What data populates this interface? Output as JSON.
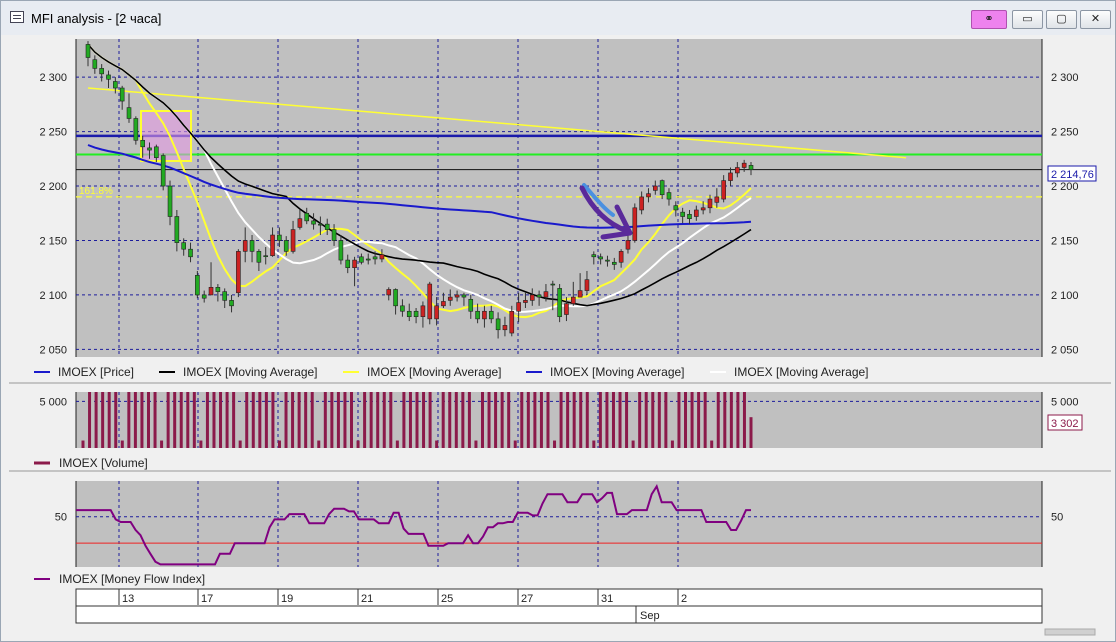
{
  "window": {
    "title": "MFI analysis - [2 часа]",
    "buttons": {
      "link": "⚭",
      "minimize": "▭",
      "restore": "▢",
      "close": "✕"
    }
  },
  "colors": {
    "plot_bg": "#c0c0c0",
    "grid": "#1c1c9c",
    "up": "#22aa22",
    "down": "#cc2222",
    "ma_black": "#000000",
    "ma_yellow": "#ffff33",
    "ma_blue": "#1a1acc",
    "ma_white": "#ffffff",
    "volume": "#8b1a4a",
    "mfi": "#800080",
    "h_blue": "#1a1aaa",
    "h_green": "#22ee22",
    "mfi_level": "#ee2222",
    "arrow_purple": "#5a2a9a",
    "arrow_blue": "#4a90e0"
  },
  "chart_data": [
    {
      "type": "candlestick",
      "title": "",
      "y_ticks": [
        "2 300",
        "2 250",
        "2 200",
        "2 150",
        "2 100",
        "2 050"
      ],
      "ylim": [
        2043,
        2335
      ],
      "current_price_label": "2 214,76",
      "fib_label": "161.8%",
      "legend": [
        "IMOEX [Price]",
        "IMOEX [Moving Average]",
        "IMOEX [Moving Average]",
        "IMOEX [Moving Average]",
        "IMOEX [Moving Average]"
      ],
      "candles": [
        [
          2318,
          2333,
          2310,
          2330
        ],
        [
          2308,
          2320,
          2303,
          2316
        ],
        [
          2303,
          2312,
          2296,
          2308
        ],
        [
          2298,
          2306,
          2290,
          2302
        ],
        [
          2290,
          2300,
          2285,
          2296
        ],
        [
          2278,
          2292,
          2270,
          2290
        ],
        [
          2262,
          2285,
          2258,
          2272
        ],
        [
          2242,
          2264,
          2238,
          2262
        ],
        [
          2236,
          2246,
          2226,
          2242
        ],
        [
          2233,
          2240,
          2225,
          2235
        ],
        [
          2226,
          2238,
          2222,
          2236
        ],
        [
          2200,
          2230,
          2196,
          2228
        ],
        [
          2172,
          2205,
          2164,
          2200
        ],
        [
          2148,
          2178,
          2140,
          2172
        ],
        [
          2142,
          2152,
          2136,
          2148
        ],
        [
          2135,
          2148,
          2130,
          2142
        ],
        [
          2100,
          2122,
          2097,
          2118
        ],
        [
          2097,
          2104,
          2093,
          2100
        ],
        [
          2107,
          2130,
          2100,
          2100
        ],
        [
          2103,
          2110,
          2094,
          2107
        ],
        [
          2095,
          2106,
          2088,
          2103
        ],
        [
          2090,
          2100,
          2084,
          2095
        ],
        [
          2140,
          2142,
          2098,
          2102
        ],
        [
          2150,
          2162,
          2130,
          2140
        ],
        [
          2140,
          2155,
          2130,
          2150
        ],
        [
          2130,
          2142,
          2122,
          2140
        ],
        [
          2136,
          2144,
          2128,
          2136
        ],
        [
          2155,
          2162,
          2135,
          2136
        ],
        [
          2150,
          2162,
          2144,
          2155
        ],
        [
          2140,
          2154,
          2136,
          2150
        ],
        [
          2160,
          2168,
          2138,
          2140
        ],
        [
          2170,
          2178,
          2160,
          2162
        ],
        [
          2168,
          2180,
          2165,
          2175
        ],
        [
          2165,
          2175,
          2160,
          2168
        ],
        [
          2165,
          2172,
          2155,
          2165
        ],
        [
          2160,
          2170,
          2155,
          2165
        ],
        [
          2150,
          2165,
          2145,
          2160
        ],
        [
          2132,
          2155,
          2128,
          2150
        ],
        [
          2125,
          2137,
          2120,
          2132
        ],
        [
          2132,
          2135,
          2108,
          2125
        ],
        [
          2130,
          2138,
          2128,
          2135
        ],
        [
          2132,
          2138,
          2128,
          2133
        ],
        [
          2133,
          2140,
          2128,
          2135
        ],
        [
          2137,
          2142,
          2130,
          2133
        ],
        [
          2105,
          2107,
          2095,
          2100
        ],
        [
          2090,
          2106,
          2082,
          2105
        ],
        [
          2085,
          2096,
          2080,
          2090
        ],
        [
          2080,
          2092,
          2076,
          2085
        ],
        [
          2080,
          2088,
          2074,
          2085
        ],
        [
          2090,
          2094,
          2070,
          2080
        ],
        [
          2110,
          2112,
          2073,
          2078
        ],
        [
          2090,
          2098,
          2072,
          2078
        ],
        [
          2094,
          2102,
          2088,
          2090
        ],
        [
          2098,
          2105,
          2090,
          2095
        ],
        [
          2100,
          2104,
          2094,
          2098
        ],
        [
          2098,
          2102,
          2090,
          2100
        ],
        [
          2085,
          2100,
          2078,
          2096
        ],
        [
          2078,
          2092,
          2074,
          2085
        ],
        [
          2085,
          2090,
          2070,
          2078
        ],
        [
          2078,
          2090,
          2074,
          2085
        ],
        [
          2068,
          2084,
          2060,
          2078
        ],
        [
          2072,
          2080,
          2062,
          2068
        ],
        [
          2085,
          2090,
          2062,
          2065
        ],
        [
          2093,
          2102,
          2075,
          2085
        ],
        [
          2095,
          2102,
          2088,
          2093
        ],
        [
          2100,
          2106,
          2090,
          2095
        ],
        [
          2098,
          2104,
          2090,
          2100
        ],
        [
          2103,
          2110,
          2094,
          2098
        ],
        [
          2110,
          2113,
          2086,
          2110
        ],
        [
          2080,
          2110,
          2075,
          2106
        ],
        [
          2092,
          2098,
          2076,
          2082
        ],
        [
          2098,
          2112,
          2090,
          2092
        ],
        [
          2104,
          2120,
          2098,
          2098
        ],
        [
          2114,
          2122,
          2100,
          2104
        ],
        [
          2135,
          2140,
          2128,
          2137
        ],
        [
          2133,
          2138,
          2128,
          2135
        ],
        [
          2131,
          2136,
          2126,
          2132
        ],
        [
          2128,
          2134,
          2123,
          2130
        ],
        [
          2140,
          2142,
          2125,
          2130
        ],
        [
          2150,
          2158,
          2138,
          2142
        ],
        [
          2180,
          2184,
          2148,
          2150
        ],
        [
          2190,
          2195,
          2174,
          2178
        ],
        [
          2193,
          2198,
          2185,
          2190
        ],
        [
          2200,
          2205,
          2192,
          2196
        ],
        [
          2192,
          2206,
          2188,
          2205
        ],
        [
          2188,
          2198,
          2182,
          2194
        ],
        [
          2178,
          2186,
          2172,
          2182
        ],
        [
          2172,
          2180,
          2166,
          2176
        ],
        [
          2170,
          2178,
          2165,
          2174
        ],
        [
          2178,
          2182,
          2168,
          2172
        ],
        [
          2180,
          2186,
          2174,
          2178
        ],
        [
          2188,
          2192,
          2175,
          2180
        ],
        [
          2190,
          2198,
          2180,
          2185
        ],
        [
          2205,
          2210,
          2185,
          2188
        ],
        [
          2212,
          2217,
          2200,
          2205
        ],
        [
          2217,
          2222,
          2208,
          2212
        ],
        [
          2221,
          2224,
          2213,
          2217
        ],
        [
          2215,
          2222,
          2210,
          2219
        ]
      ]
    },
    {
      "type": "bar",
      "title": "",
      "y_ticks": [
        "5 000"
      ],
      "ylim": [
        0,
        6000
      ],
      "current_value_label": "3 302",
      "legend": [
        "IMOEX [Volume]"
      ],
      "values": [
        800,
        6000,
        6000,
        6000,
        6000,
        6000,
        800,
        6000,
        6000,
        6000,
        6000,
        6000,
        800,
        6000,
        6000,
        6000,
        6000,
        6000,
        800,
        6000,
        6000,
        6000,
        6000,
        6000,
        800,
        6000,
        6000,
        6000,
        6000,
        6000,
        800,
        6000,
        6000,
        6000,
        6000,
        6000,
        800,
        6000,
        6000,
        6000,
        6000,
        6000,
        800,
        6000,
        6000,
        6000,
        6000,
        6000,
        800,
        6000,
        6000,
        6000,
        6000,
        6000,
        800,
        6000,
        6000,
        6000,
        6000,
        6000,
        800,
        6000,
        6000,
        6000,
        6000,
        6000,
        800,
        6000,
        6000,
        6000,
        6000,
        6000,
        800,
        6000,
        6000,
        6000,
        6000,
        6000,
        800,
        6000,
        6000,
        6000,
        6000,
        6000,
        800,
        6000,
        6000,
        6000,
        6000,
        6000,
        800,
        6000,
        6000,
        6000,
        6000,
        6000,
        800,
        6000,
        6000,
        6000,
        6000,
        6000,
        3302
      ]
    },
    {
      "type": "line",
      "title": "",
      "y_ticks": [
        "50"
      ],
      "ylim": [
        12,
        77
      ],
      "level": 30,
      "legend": [
        "IMOEX [Money Flow Index]"
      ],
      "values": [
        55,
        55,
        55,
        55,
        55,
        55,
        55,
        55,
        48,
        46,
        46,
        46,
        40,
        36,
        28,
        22,
        16,
        14,
        14,
        14,
        14,
        14,
        14,
        14,
        14,
        14,
        14,
        14,
        14,
        22,
        22,
        22,
        30,
        30,
        30,
        30,
        30,
        30,
        30,
        42,
        48,
        48,
        48,
        52,
        52,
        52,
        52,
        45,
        45,
        45,
        45,
        52,
        56,
        56,
        56,
        54,
        54,
        48,
        48,
        48,
        48,
        45,
        45,
        45,
        53,
        53,
        41,
        37,
        37,
        37,
        37,
        28,
        28,
        28,
        28,
        30,
        30,
        30,
        30,
        36,
        30,
        30,
        35,
        42,
        42,
        45,
        45,
        46,
        46,
        53,
        53,
        53,
        51,
        51,
        60,
        67,
        67,
        67,
        67,
        61,
        61,
        61,
        67,
        67,
        67,
        61,
        64,
        68,
        68,
        52,
        52,
        52,
        55,
        55,
        55,
        55,
        67,
        73,
        61,
        61,
        61,
        55,
        55,
        55,
        55,
        55,
        55,
        46,
        46,
        46,
        46,
        46,
        40,
        40,
        47,
        55,
        55
      ]
    }
  ],
  "x_axis": {
    "labels": [
      "13",
      "17",
      "19",
      "21",
      "25",
      "27",
      "31",
      "2"
    ],
    "month_label": "Sep"
  }
}
